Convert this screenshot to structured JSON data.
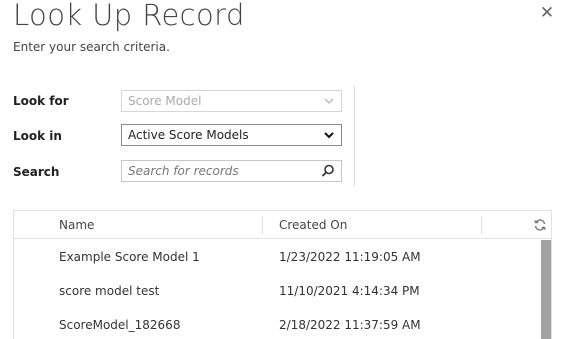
{
  "dialog": {
    "title": "Look Up Record",
    "subtitle": "Enter your search criteria.",
    "close_icon": "close-icon"
  },
  "form": {
    "look_for": {
      "label": "Look for",
      "value": "Score Model",
      "disabled": true
    },
    "look_in": {
      "label": "Look in",
      "value": "Active Score Models"
    },
    "search": {
      "label": "Search",
      "placeholder": "Search for records",
      "icon": "search-icon"
    }
  },
  "grid": {
    "columns": [
      "Name",
      "Created On"
    ],
    "refresh_icon": "refresh-icon",
    "rows": [
      {
        "name": "Example Score Model 1",
        "created_on": "1/23/2022 11:19:05 AM"
      },
      {
        "name": "score model test",
        "created_on": "11/10/2021 4:14:34 PM"
      },
      {
        "name": "ScoreModel_182668",
        "created_on": "2/18/2022 11:37:59 AM"
      }
    ]
  },
  "colors": {
    "text": "#444444",
    "border": "#c8c8c8",
    "scrollbar": "#a3a3a3"
  }
}
